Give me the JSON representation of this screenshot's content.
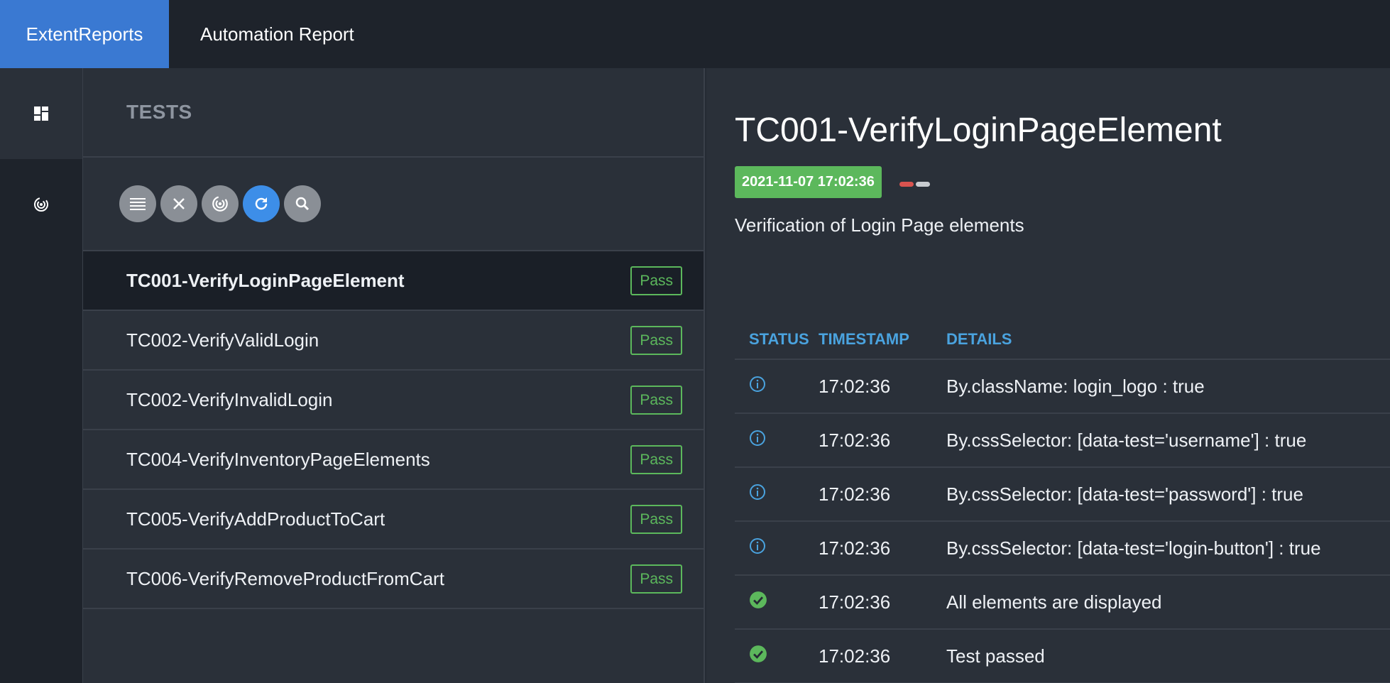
{
  "header": {
    "brand": "ExtentReports",
    "title": "Automation Report"
  },
  "sidenav": {
    "items": [
      {
        "icon": "dashboard-icon"
      },
      {
        "icon": "radar-icon"
      }
    ]
  },
  "tests_panel": {
    "title": "TESTS",
    "toolbar": [
      "list-icon",
      "close-icon",
      "radar-icon",
      "refresh-icon",
      "search-icon"
    ],
    "tests": [
      {
        "name": "TC001-VerifyLoginPageElement",
        "status": "Pass"
      },
      {
        "name": "TC002-VerifyValidLogin",
        "status": "Pass"
      },
      {
        "name": "TC002-VerifyInvalidLogin",
        "status": "Pass"
      },
      {
        "name": "TC004-VerifyInventoryPageElements",
        "status": "Pass"
      },
      {
        "name": "TC005-VerifyAddProductToCart",
        "status": "Pass"
      },
      {
        "name": "TC006-VerifyRemoveProductFromCart",
        "status": "Pass"
      }
    ]
  },
  "detail": {
    "title": "TC001-VerifyLoginPageElement",
    "timestamp": "2021-11-07 17:02:36",
    "description": "Verification of Login Page elements",
    "columns": {
      "status": "STATUS",
      "timestamp": "TIMESTAMP",
      "details": "DETAILS"
    },
    "logs": [
      {
        "status": "info",
        "time": "17:02:36",
        "details": "By.className: login_logo : true"
      },
      {
        "status": "info",
        "time": "17:02:36",
        "details": "By.cssSelector: [data-test='username'] : true"
      },
      {
        "status": "info",
        "time": "17:02:36",
        "details": "By.cssSelector: [data-test='password'] : true"
      },
      {
        "status": "info",
        "time": "17:02:36",
        "details": "By.cssSelector: [data-test='login-button'] : true"
      },
      {
        "status": "pass",
        "time": "17:02:36",
        "details": "All elements are displayed"
      },
      {
        "status": "pass",
        "time": "17:02:36",
        "details": "Test passed"
      }
    ]
  },
  "colors": {
    "brand": "#3a79d2",
    "pass": "#5cb85c",
    "info": "#4aa3df",
    "active_button": "#3d8ee8"
  }
}
